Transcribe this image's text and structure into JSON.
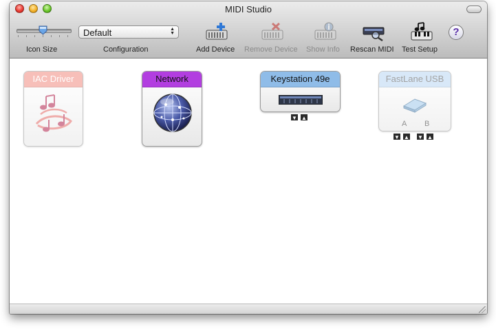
{
  "window": {
    "title": "MIDI Studio"
  },
  "toolbar": {
    "icon_size_label": "Icon Size",
    "configuration_label": "Configuration",
    "configuration_value": "Default",
    "add_device_label": "Add Device",
    "remove_device_label": "Remove Device",
    "show_info_label": "Show Info",
    "rescan_midi_label": "Rescan MIDI",
    "test_setup_label": "Test Setup",
    "help_symbol": "?"
  },
  "devices": [
    {
      "name": "IAC Driver",
      "color": "#f08a80",
      "icon": "music-notes-icon",
      "faded": true
    },
    {
      "name": "Network",
      "color": "#b23ee0",
      "icon": "network-globe-icon",
      "faded": false
    },
    {
      "name": "Keystation 49e",
      "color": "#8fbce8",
      "icon": "keyboard-icon",
      "faded": false
    },
    {
      "name": "FastLane USB",
      "color": "#b9d6f2",
      "icon": "interface-icon",
      "faded": true,
      "ports": [
        "A",
        "B"
      ]
    }
  ],
  "icons": {
    "close": "close-button",
    "minimize": "minimize-button",
    "maximize": "zoom-button",
    "toolbar_toggle": "toolbar-toggle",
    "add_device": "add-keyboard-icon",
    "remove_device": "remove-keyboard-icon",
    "show_info": "info-keyboard-icon",
    "rescan": "rescan-magnifier-icon",
    "test_setup": "test-keyboard-icon",
    "help": "help-icon"
  }
}
